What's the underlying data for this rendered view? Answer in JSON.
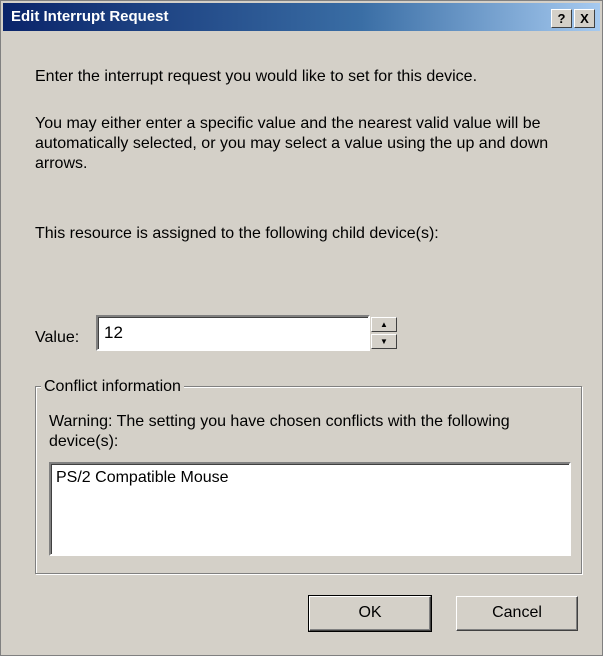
{
  "window": {
    "title": "Edit Interrupt Request",
    "help_glyph": "?",
    "close_glyph": "X"
  },
  "content": {
    "intro": "Enter the interrupt request you would like to set for this device.",
    "instructions": "You may either enter a specific value and the nearest valid value will be automatically selected, or you may select a value using the up and down arrows.",
    "assigned_text": "This resource is assigned to the following child device(s):"
  },
  "value_field": {
    "label": "Value:",
    "value": "12",
    "spin_up_glyph": "▲",
    "spin_down_glyph": "▼"
  },
  "conflict": {
    "group_label": "Conflict information",
    "warning": "Warning: The setting you have chosen conflicts with the following device(s):",
    "devices": [
      "PS/2 Compatible Mouse"
    ]
  },
  "buttons": {
    "ok": "OK",
    "cancel": "Cancel"
  },
  "colors": {
    "titlebar_start": "#0a246a",
    "titlebar_end": "#a6caf0",
    "face": "#d4d0c8"
  }
}
